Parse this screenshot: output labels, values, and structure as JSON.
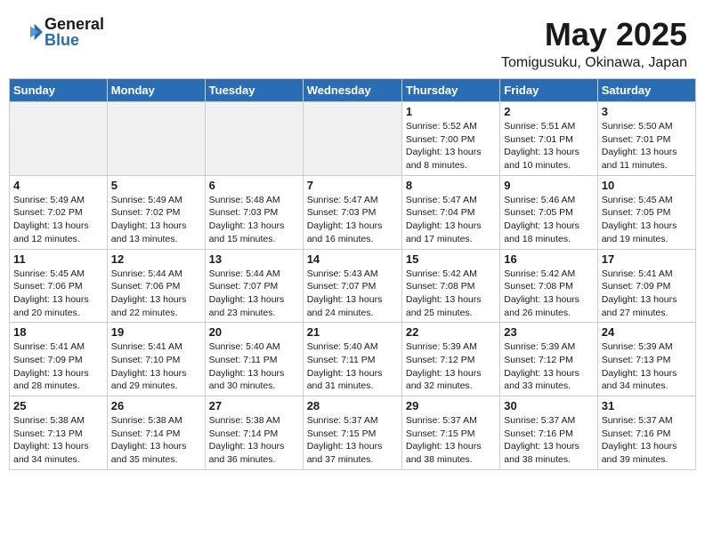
{
  "logo": {
    "general": "General",
    "blue": "Blue"
  },
  "title": "May 2025",
  "location": "Tomigusuku, Okinawa, Japan",
  "days_of_week": [
    "Sunday",
    "Monday",
    "Tuesday",
    "Wednesday",
    "Thursday",
    "Friday",
    "Saturday"
  ],
  "weeks": [
    [
      {
        "day": "",
        "empty": true
      },
      {
        "day": "",
        "empty": true
      },
      {
        "day": "",
        "empty": true
      },
      {
        "day": "",
        "empty": true
      },
      {
        "day": "1",
        "sunrise": "5:52 AM",
        "sunset": "7:00 PM",
        "daylight": "13 hours and 8 minutes."
      },
      {
        "day": "2",
        "sunrise": "5:51 AM",
        "sunset": "7:01 PM",
        "daylight": "13 hours and 10 minutes."
      },
      {
        "day": "3",
        "sunrise": "5:50 AM",
        "sunset": "7:01 PM",
        "daylight": "13 hours and 11 minutes."
      }
    ],
    [
      {
        "day": "4",
        "sunrise": "5:49 AM",
        "sunset": "7:02 PM",
        "daylight": "13 hours and 12 minutes."
      },
      {
        "day": "5",
        "sunrise": "5:49 AM",
        "sunset": "7:02 PM",
        "daylight": "13 hours and 13 minutes."
      },
      {
        "day": "6",
        "sunrise": "5:48 AM",
        "sunset": "7:03 PM",
        "daylight": "13 hours and 15 minutes."
      },
      {
        "day": "7",
        "sunrise": "5:47 AM",
        "sunset": "7:03 PM",
        "daylight": "13 hours and 16 minutes."
      },
      {
        "day": "8",
        "sunrise": "5:47 AM",
        "sunset": "7:04 PM",
        "daylight": "13 hours and 17 minutes."
      },
      {
        "day": "9",
        "sunrise": "5:46 AM",
        "sunset": "7:05 PM",
        "daylight": "13 hours and 18 minutes."
      },
      {
        "day": "10",
        "sunrise": "5:45 AM",
        "sunset": "7:05 PM",
        "daylight": "13 hours and 19 minutes."
      }
    ],
    [
      {
        "day": "11",
        "sunrise": "5:45 AM",
        "sunset": "7:06 PM",
        "daylight": "13 hours and 20 minutes."
      },
      {
        "day": "12",
        "sunrise": "5:44 AM",
        "sunset": "7:06 PM",
        "daylight": "13 hours and 22 minutes."
      },
      {
        "day": "13",
        "sunrise": "5:44 AM",
        "sunset": "7:07 PM",
        "daylight": "13 hours and 23 minutes."
      },
      {
        "day": "14",
        "sunrise": "5:43 AM",
        "sunset": "7:07 PM",
        "daylight": "13 hours and 24 minutes."
      },
      {
        "day": "15",
        "sunrise": "5:42 AM",
        "sunset": "7:08 PM",
        "daylight": "13 hours and 25 minutes."
      },
      {
        "day": "16",
        "sunrise": "5:42 AM",
        "sunset": "7:08 PM",
        "daylight": "13 hours and 26 minutes."
      },
      {
        "day": "17",
        "sunrise": "5:41 AM",
        "sunset": "7:09 PM",
        "daylight": "13 hours and 27 minutes."
      }
    ],
    [
      {
        "day": "18",
        "sunrise": "5:41 AM",
        "sunset": "7:09 PM",
        "daylight": "13 hours and 28 minutes."
      },
      {
        "day": "19",
        "sunrise": "5:41 AM",
        "sunset": "7:10 PM",
        "daylight": "13 hours and 29 minutes."
      },
      {
        "day": "20",
        "sunrise": "5:40 AM",
        "sunset": "7:11 PM",
        "daylight": "13 hours and 30 minutes."
      },
      {
        "day": "21",
        "sunrise": "5:40 AM",
        "sunset": "7:11 PM",
        "daylight": "13 hours and 31 minutes."
      },
      {
        "day": "22",
        "sunrise": "5:39 AM",
        "sunset": "7:12 PM",
        "daylight": "13 hours and 32 minutes."
      },
      {
        "day": "23",
        "sunrise": "5:39 AM",
        "sunset": "7:12 PM",
        "daylight": "13 hours and 33 minutes."
      },
      {
        "day": "24",
        "sunrise": "5:39 AM",
        "sunset": "7:13 PM",
        "daylight": "13 hours and 34 minutes."
      }
    ],
    [
      {
        "day": "25",
        "sunrise": "5:38 AM",
        "sunset": "7:13 PM",
        "daylight": "13 hours and 34 minutes."
      },
      {
        "day": "26",
        "sunrise": "5:38 AM",
        "sunset": "7:14 PM",
        "daylight": "13 hours and 35 minutes."
      },
      {
        "day": "27",
        "sunrise": "5:38 AM",
        "sunset": "7:14 PM",
        "daylight": "13 hours and 36 minutes."
      },
      {
        "day": "28",
        "sunrise": "5:37 AM",
        "sunset": "7:15 PM",
        "daylight": "13 hours and 37 minutes."
      },
      {
        "day": "29",
        "sunrise": "5:37 AM",
        "sunset": "7:15 PM",
        "daylight": "13 hours and 38 minutes."
      },
      {
        "day": "30",
        "sunrise": "5:37 AM",
        "sunset": "7:16 PM",
        "daylight": "13 hours and 38 minutes."
      },
      {
        "day": "31",
        "sunrise": "5:37 AM",
        "sunset": "7:16 PM",
        "daylight": "13 hours and 39 minutes."
      }
    ]
  ]
}
